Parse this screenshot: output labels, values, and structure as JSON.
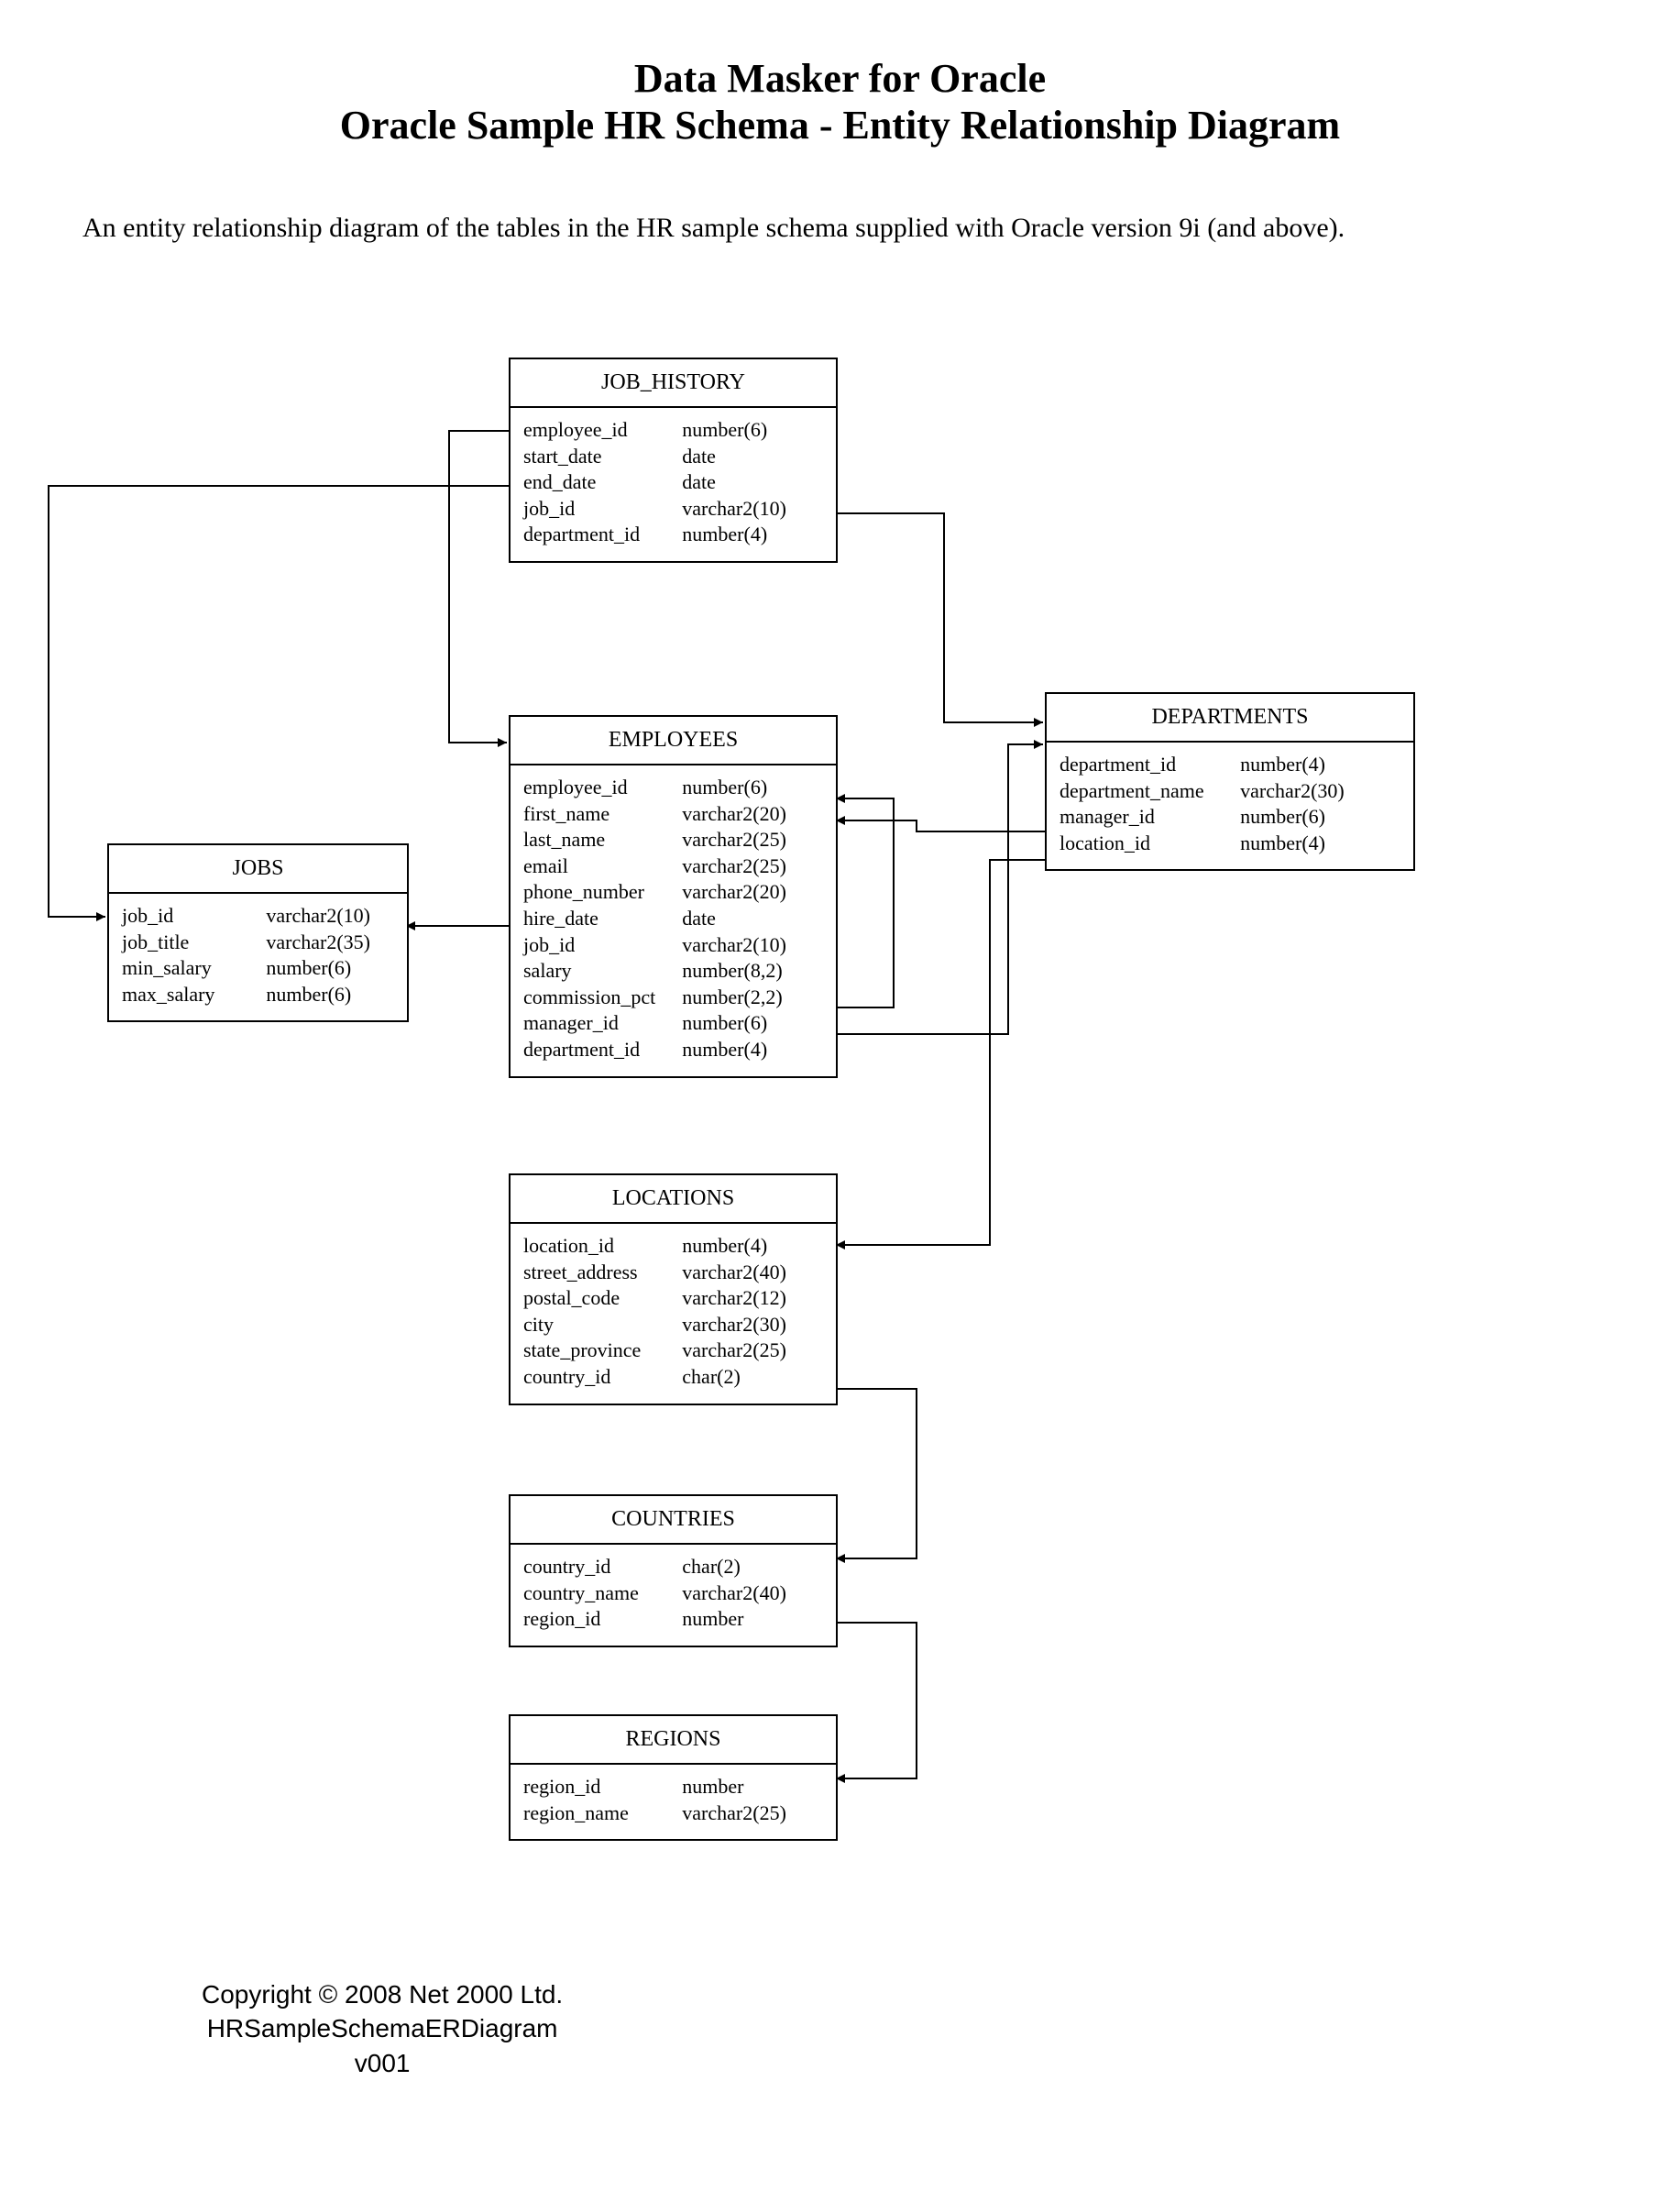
{
  "header": {
    "line1": "Data Masker for Oracle",
    "line2": "Oracle Sample HR Schema - Entity Relationship Diagram"
  },
  "description": "An entity relationship diagram of the tables in the HR sample schema supplied with Oracle version 9i (and above).",
  "entities": {
    "job_history": {
      "title": "JOB_HISTORY",
      "attrs": [
        {
          "name": "employee_id",
          "type": "number(6)"
        },
        {
          "name": "start_date",
          "type": "date"
        },
        {
          "name": "end_date",
          "type": "date"
        },
        {
          "name": "job_id",
          "type": "varchar2(10)"
        },
        {
          "name": "department_id",
          "type": "number(4)"
        }
      ]
    },
    "employees": {
      "title": "EMPLOYEES",
      "attrs": [
        {
          "name": "employee_id",
          "type": "number(6)"
        },
        {
          "name": "first_name",
          "type": "varchar2(20)"
        },
        {
          "name": "last_name",
          "type": "varchar2(25)"
        },
        {
          "name": "email",
          "type": "varchar2(25)"
        },
        {
          "name": "phone_number",
          "type": "varchar2(20)"
        },
        {
          "name": "hire_date",
          "type": "date"
        },
        {
          "name": "job_id",
          "type": "varchar2(10)"
        },
        {
          "name": "salary",
          "type": "number(8,2)"
        },
        {
          "name": "commission_pct",
          "type": "number(2,2)"
        },
        {
          "name": "manager_id",
          "type": "number(6)"
        },
        {
          "name": "department_id",
          "type": "number(4)"
        }
      ]
    },
    "jobs": {
      "title": "JOBS",
      "attrs": [
        {
          "name": "job_id",
          "type": "varchar2(10)"
        },
        {
          "name": "job_title",
          "type": "varchar2(35)"
        },
        {
          "name": "min_salary",
          "type": "number(6)"
        },
        {
          "name": "max_salary",
          "type": "number(6)"
        }
      ]
    },
    "departments": {
      "title": "DEPARTMENTS",
      "attrs": [
        {
          "name": "department_id",
          "type": "number(4)"
        },
        {
          "name": "department_name",
          "type": "varchar2(30)"
        },
        {
          "name": "manager_id",
          "type": "number(6)"
        },
        {
          "name": "location_id",
          "type": "number(4)"
        }
      ]
    },
    "locations": {
      "title": "LOCATIONS",
      "attrs": [
        {
          "name": "location_id",
          "type": "number(4)"
        },
        {
          "name": "street_address",
          "type": "varchar2(40)"
        },
        {
          "name": "postal_code",
          "type": "varchar2(12)"
        },
        {
          "name": "city",
          "type": "varchar2(30)"
        },
        {
          "name": "state_province",
          "type": "varchar2(25)"
        },
        {
          "name": "country_id",
          "type": "char(2)"
        }
      ]
    },
    "countries": {
      "title": "COUNTRIES",
      "attrs": [
        {
          "name": "country_id",
          "type": "char(2)"
        },
        {
          "name": "country_name",
          "type": "varchar2(40)"
        },
        {
          "name": "region_id",
          "type": "number"
        }
      ]
    },
    "regions": {
      "title": "REGIONS",
      "attrs": [
        {
          "name": "region_id",
          "type": "number"
        },
        {
          "name": "region_name",
          "type": "varchar2(25)"
        }
      ]
    }
  },
  "relationships": [
    {
      "from": "JOB_HISTORY.employee_id",
      "to": "EMPLOYEES.employee_id"
    },
    {
      "from": "JOB_HISTORY.job_id",
      "to": "JOBS.job_id"
    },
    {
      "from": "JOB_HISTORY.department_id",
      "to": "DEPARTMENTS.department_id"
    },
    {
      "from": "EMPLOYEES.job_id",
      "to": "JOBS.job_id"
    },
    {
      "from": "EMPLOYEES.department_id",
      "to": "DEPARTMENTS.department_id"
    },
    {
      "from": "EMPLOYEES.manager_id",
      "to": "EMPLOYEES.employee_id"
    },
    {
      "from": "DEPARTMENTS.manager_id",
      "to": "EMPLOYEES.employee_id"
    },
    {
      "from": "DEPARTMENTS.location_id",
      "to": "LOCATIONS.location_id"
    },
    {
      "from": "LOCATIONS.country_id",
      "to": "COUNTRIES.country_id"
    },
    {
      "from": "COUNTRIES.region_id",
      "to": "REGIONS.region_id"
    }
  ],
  "footer": {
    "line1": "Copyright © 2008 Net 2000 Ltd.",
    "line2": "HRSampleSchemaERDiagram",
    "line3": "v001"
  }
}
